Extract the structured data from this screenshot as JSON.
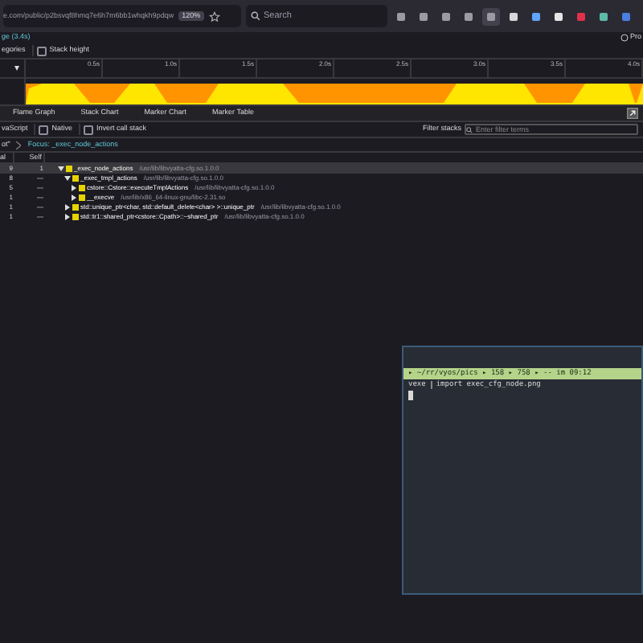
{
  "browser": {
    "url": "e.com/public/p2bsvqf8hmq7e6h7m6bb1whqkh9pdqw",
    "zoom": "120%",
    "search_placeholder": "Search",
    "profile_label": "Pro"
  },
  "profile": {
    "range_label": "ge (3.4s)",
    "options": [
      {
        "label": "egories"
      },
      {
        "label": "Stack height",
        "checked": false
      }
    ]
  },
  "timeline": {
    "ticks": [
      "0.5s",
      "1.0s",
      "1.5s",
      "2.0s",
      "2.5s",
      "3.0s",
      "3.5s",
      "4.0s"
    ]
  },
  "tabs": [
    {
      "label": "Flame Graph",
      "selected": false
    },
    {
      "label": "Stack Chart",
      "selected": false
    },
    {
      "label": "Marker Chart",
      "selected": false
    },
    {
      "label": "Marker Table",
      "selected": false
    }
  ],
  "settings": {
    "options": [
      {
        "label": "vaScript"
      },
      {
        "label": "Native",
        "checked": false
      },
      {
        "label": "Invert call stack",
        "checked": false
      }
    ],
    "filter_label": "Filter stacks",
    "filter_placeholder": "Enter filter terms"
  },
  "breadcrumbs": [
    "ot\"",
    "Focus: _exec_node_actions"
  ],
  "call_tree": {
    "columns": [
      "al",
      "Self"
    ],
    "rows": [
      {
        "total": "9",
        "self": "1",
        "name": "_exec_node_actions",
        "lib": "/usr/lib/libvyatta-cfg.so.1.0.0",
        "selected": true,
        "expanded": true,
        "children": [
          {
            "total": "8",
            "self": "—",
            "name": "_exec_tmpl_actions",
            "lib": "/usr/lib/libvyatta-cfg.so.1.0.0",
            "selected": false,
            "expanded": true,
            "children": [
              {
                "total": "5",
                "self": "—",
                "name": "cstore::Cstore::executeTmplActions",
                "lib": "/usr/lib/libvyatta-cfg.so.1.0.0",
                "selected": false,
                "expanded": false
              },
              {
                "total": "1",
                "self": "—",
                "name": "__execve",
                "lib": "/usr/lib/x86_64-linux-gnu/libc-2.31.so",
                "selected": false,
                "expanded": false
              }
            ]
          },
          {
            "total": "1",
            "self": "—",
            "name": "std::unique_ptr<char, std::default_delete<char> >::unique_ptr",
            "lib": "/usr/lib/libvyatta-cfg.so.1.0.0",
            "selected": false,
            "expanded": false
          },
          {
            "total": "1",
            "self": "—",
            "name": "std::tr1::shared_ptr<cstore::Cpath>::~shared_ptr",
            "lib": "/usr/lib/libvyatta-cfg.so.1.0.0",
            "selected": false,
            "expanded": false
          }
        ]
      }
    ]
  },
  "terminal": {
    "status": "▸ ~/rr/vyos/pics ▸ 158 ▸ 758 ▸ -- im 09:12",
    "line_prompt": "vexe",
    "line_command": "import exec_cfg_node.png"
  }
}
